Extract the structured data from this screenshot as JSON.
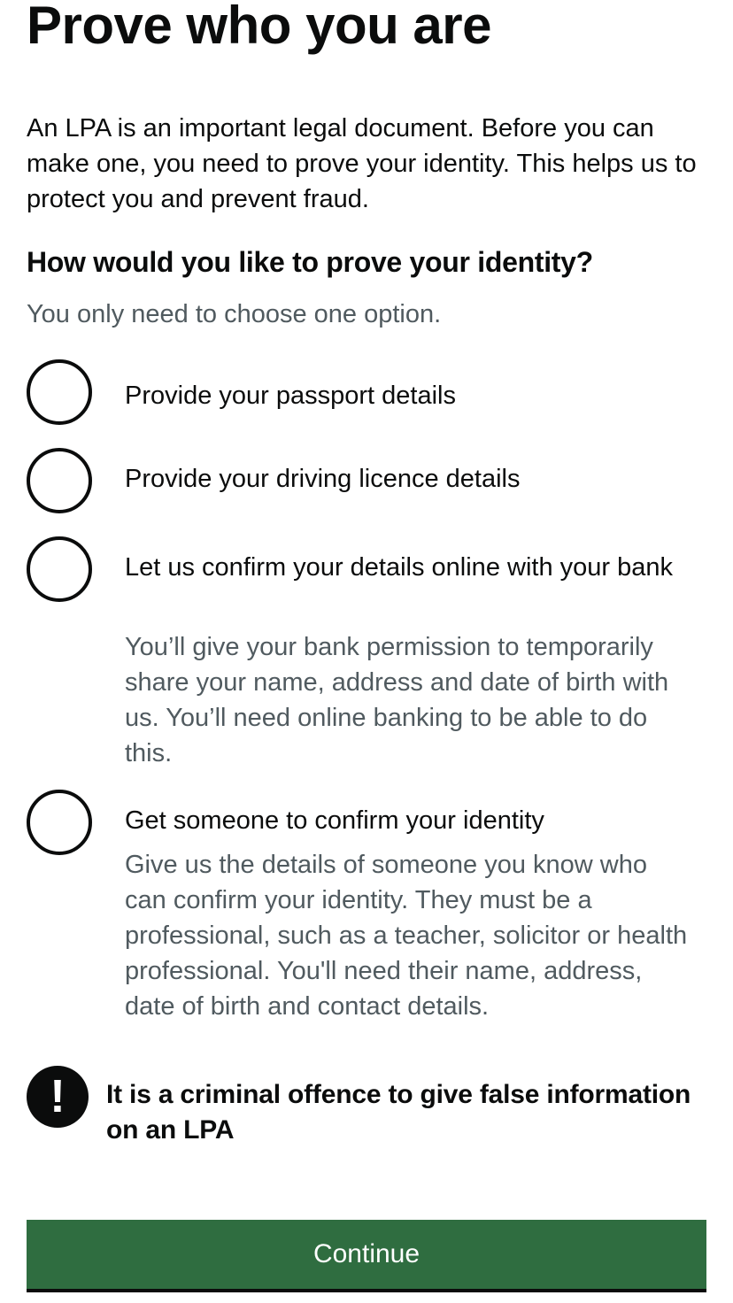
{
  "title": "Prove who you are",
  "intro": "An LPA is an important legal document. Before you can make one, you need to prove your identity. This helps us to protect you and prevent fraud.",
  "question": "How would you like to prove your identity?",
  "hint": "You only need to choose one option.",
  "options": [
    {
      "label": "Provide your passport details",
      "hint": ""
    },
    {
      "label": "Provide your driving licence details",
      "hint": ""
    },
    {
      "label": "Let us confirm your details online with your bank",
      "hint": "You’ll give your bank permission to temporarily share your name, address and date of birth with us. You’ll need online banking to be able to do this."
    },
    {
      "label": "Get someone to confirm your identity",
      "hint": "Give us the details of someone you know who can confirm your identity. They must be a professional, such as a teacher, solicitor or health professional. You'll need their name, address, date of birth and contact details."
    }
  ],
  "warning": {
    "icon": "!",
    "text": "It is a criminal offence to give false information on an LPA"
  },
  "continue_label": "Continue"
}
